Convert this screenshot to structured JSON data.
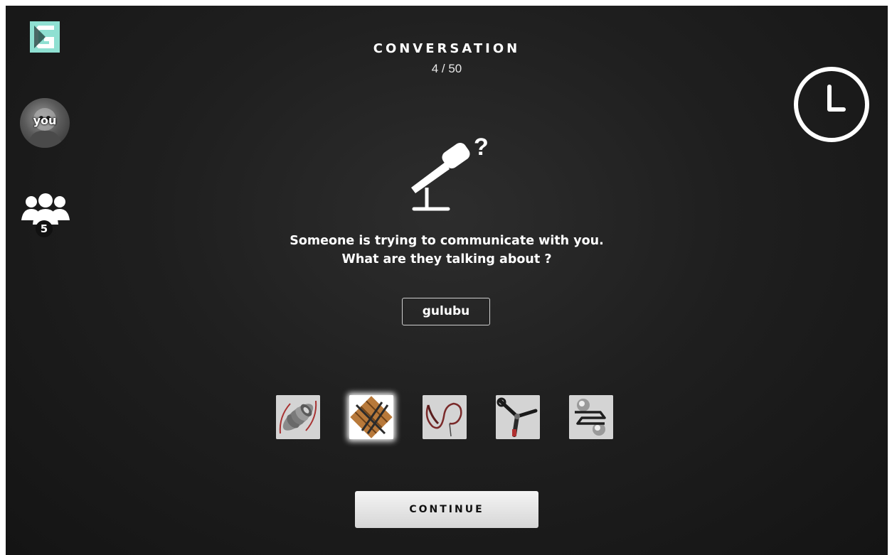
{
  "header": {
    "title": "CONVERSATION",
    "progress": "4 / 50"
  },
  "sidebar": {
    "logo": "game-logo",
    "avatar_label": "you",
    "group_count": "5"
  },
  "prompt": {
    "line1": "Someone is trying to communicate with you.",
    "line2": "What are they talking about ?"
  },
  "word": "gulubu",
  "options": [
    {
      "icon": "coil-stack-icon",
      "selected": false
    },
    {
      "icon": "wooden-planks-icon",
      "selected": true
    },
    {
      "icon": "whip-icon",
      "selected": false
    },
    {
      "icon": "tool-handle-icon",
      "selected": false
    },
    {
      "icon": "metal-bracket-icon",
      "selected": false
    }
  ],
  "continue_label": "CONTINUE",
  "colors": {
    "background": "#1f1f1f",
    "text": "#ffffff",
    "logo_teal": "#7fd4c7",
    "button": "#e6e6e6"
  }
}
